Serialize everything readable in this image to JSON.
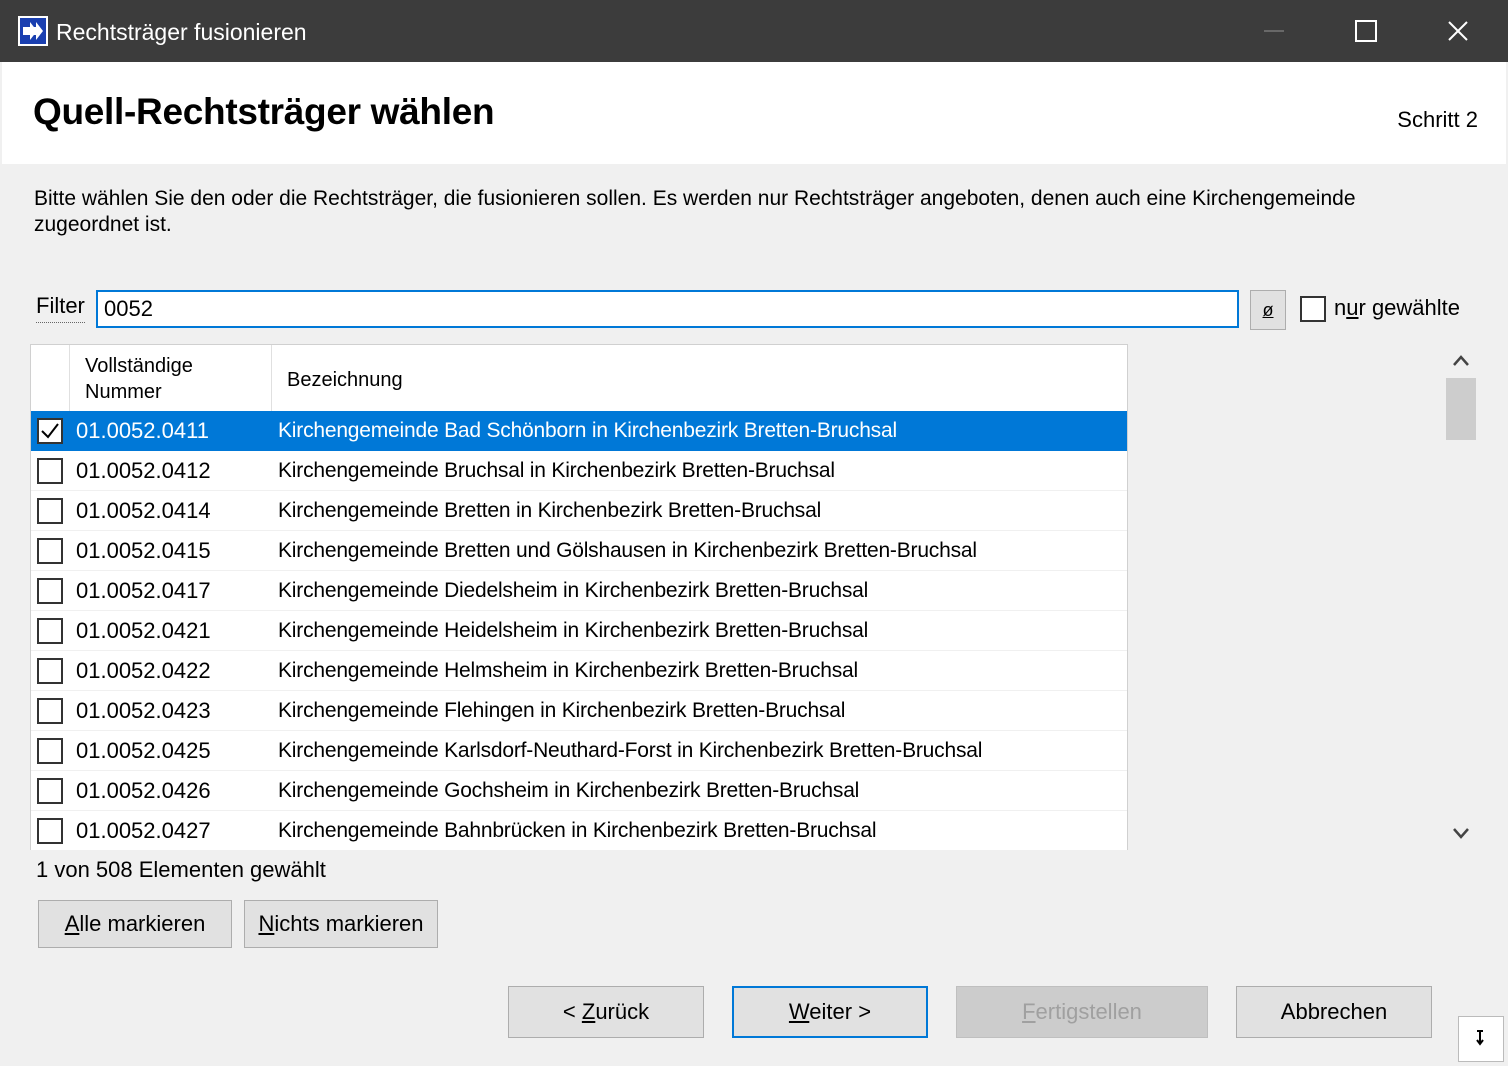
{
  "window": {
    "title": "Rechtsträger fusionieren",
    "controls": {
      "minimize": "minimize-icon",
      "maximize": "maximize-icon",
      "close": "close-icon"
    }
  },
  "header": {
    "title": "Quell-Rechtsträger wählen",
    "step": "Schritt 2"
  },
  "description": "Bitte wählen Sie den oder die Rechtsträger, die fusionieren sollen. Es werden nur Rechtsträger angeboten, denen auch eine Kirchengemeinde zugeordnet ist.",
  "filter": {
    "label": "Filter",
    "value": "0052",
    "clear_label": "ø",
    "only_selected_label": "nur gewählte",
    "only_selected_checked": false
  },
  "list": {
    "columns": {
      "number": "Vollständige\nNummer",
      "name": "Bezeichnung"
    },
    "rows": [
      {
        "number": "01.0052.0411",
        "name": "Kirchengemeinde Bad Schönborn in Kirchenbezirk Bretten-Bruchsal",
        "checked": true,
        "selected": true
      },
      {
        "number": "01.0052.0412",
        "name": "Kirchengemeinde Bruchsal in Kirchenbezirk Bretten-Bruchsal",
        "checked": false,
        "selected": false
      },
      {
        "number": "01.0052.0414",
        "name": "Kirchengemeinde Bretten in Kirchenbezirk Bretten-Bruchsal",
        "checked": false,
        "selected": false
      },
      {
        "number": "01.0052.0415",
        "name": "Kirchengemeinde Bretten und Gölshausen in Kirchenbezirk Bretten-Bruchsal",
        "checked": false,
        "selected": false
      },
      {
        "number": "01.0052.0417",
        "name": "Kirchengemeinde Diedelsheim in Kirchenbezirk Bretten-Bruchsal",
        "checked": false,
        "selected": false
      },
      {
        "number": "01.0052.0421",
        "name": "Kirchengemeinde Heidelsheim in Kirchenbezirk Bretten-Bruchsal",
        "checked": false,
        "selected": false
      },
      {
        "number": "01.0052.0422",
        "name": "Kirchengemeinde Helmsheim in Kirchenbezirk Bretten-Bruchsal",
        "checked": false,
        "selected": false
      },
      {
        "number": "01.0052.0423",
        "name": "Kirchengemeinde Flehingen in Kirchenbezirk Bretten-Bruchsal",
        "checked": false,
        "selected": false
      },
      {
        "number": "01.0052.0425",
        "name": "Kirchengemeinde Karlsdorf-Neuthard-Forst in Kirchenbezirk Bretten-Bruchsal",
        "checked": false,
        "selected": false
      },
      {
        "number": "01.0052.0426",
        "name": "Kirchengemeinde Gochsheim in Kirchenbezirk Bretten-Bruchsal",
        "checked": false,
        "selected": false
      },
      {
        "number": "01.0052.0427",
        "name": "Kirchengemeinde Bahnbrücken in Kirchenbezirk Bretten-Bruchsal",
        "checked": false,
        "selected": false
      }
    ]
  },
  "status": "1 von 508 Elementen gewählt",
  "buttons": {
    "select_all": "Alle markieren",
    "select_none": "Nichts markieren",
    "back": "< Zurück",
    "next": "Weiter >",
    "finish": "Fertigstellen",
    "cancel": "Abbrechen"
  },
  "colors": {
    "accent": "#0078d7",
    "titlebar": "#3c3c3c"
  }
}
